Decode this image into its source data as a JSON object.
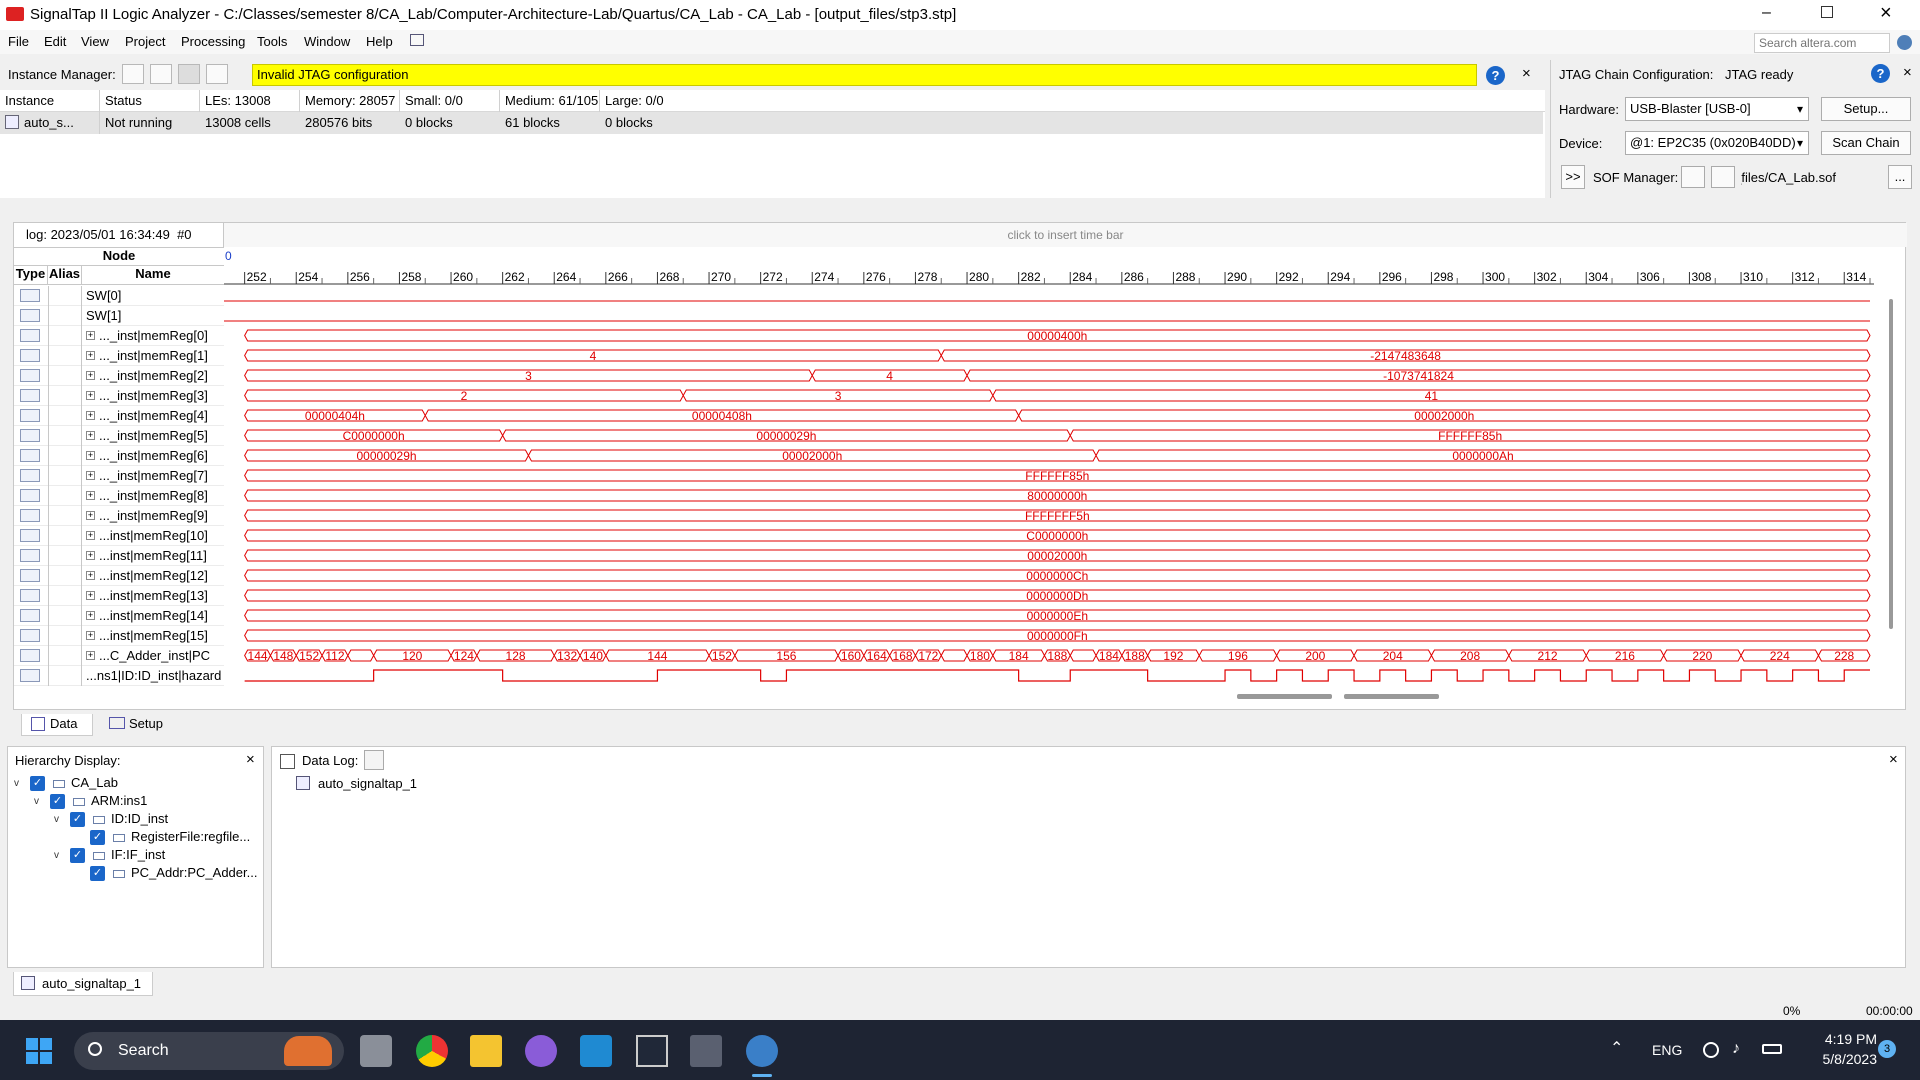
{
  "window": {
    "title": "SignalTap II Logic Analyzer - C:/Classes/semester 8/CA_Lab/Computer-Architecture-Lab/Quartus/CA_Lab - CA_Lab - [output_files/stp3.stp]"
  },
  "menu": [
    "File",
    "Edit",
    "View",
    "Project",
    "Processing",
    "Tools",
    "Window",
    "Help"
  ],
  "search": {
    "placeholder": "Search altera.com"
  },
  "instance_manager": {
    "label": "Instance Manager:",
    "status": "Invalid JTAG configuration",
    "headers": [
      "Instance",
      "Status",
      "LEs: 13008",
      "Memory: 28057",
      "Small: 0/0",
      "Medium: 61/105",
      "Large: 0/0"
    ],
    "row": [
      "auto_s...",
      "Not running",
      "13008 cells",
      "280576 bits",
      "0 blocks",
      "61 blocks",
      "0 blocks"
    ]
  },
  "jtag": {
    "label": "JTAG Chain Configuration:",
    "status": "JTAG ready",
    "hardware_label": "Hardware:",
    "hardware": "USB-Blaster [USB-0]",
    "setup": "Setup...",
    "device_label": "Device:",
    "device": "@1: EP2C35 (0x020B40DD)",
    "scan": "Scan Chain",
    "sof_arrow": ">>",
    "sof_label": "SOF Manager:",
    "sof_file": "output_files/CA_Lab.sof",
    "more": "..."
  },
  "waveform": {
    "log": "log: 2023/05/01 16:34:49  #0",
    "insert_hint": "click to insert time bar",
    "node_header": "Node",
    "type_header": "Type",
    "alias_header": "Alias",
    "name_header": "Name",
    "cursor": "0",
    "ticks": [
      "252",
      "254",
      "256",
      "258",
      "260",
      "262",
      "264",
      "266",
      "268",
      "270",
      "272",
      "274",
      "276",
      "278",
      "280",
      "282",
      "284",
      "286",
      "288",
      "290",
      "292",
      "294",
      "296",
      "298",
      "300",
      "302",
      "304",
      "306",
      "308",
      "310",
      "312",
      "314"
    ],
    "signals": [
      {
        "name": "SW[0]",
        "kind": "in",
        "segments": []
      },
      {
        "name": "SW[1]",
        "kind": "in",
        "segments": []
      },
      {
        "name": "..._inst|memReg[0]",
        "kind": "bus",
        "segments": [
          [
            252,
            316,
            "00000400h"
          ]
        ]
      },
      {
        "name": "..._inst|memReg[1]",
        "kind": "bus",
        "segments": [
          [
            252,
            279,
            "4"
          ],
          [
            279,
            316,
            "-2147483648"
          ]
        ]
      },
      {
        "name": "..._inst|memReg[2]",
        "kind": "bus",
        "segments": [
          [
            252,
            274,
            "3"
          ],
          [
            274,
            280,
            "4"
          ],
          [
            280,
            316,
            "-1073741824"
          ]
        ]
      },
      {
        "name": "..._inst|memReg[3]",
        "kind": "bus",
        "segments": [
          [
            252,
            269,
            "2"
          ],
          [
            269,
            281,
            "3"
          ],
          [
            281,
            316,
            "41"
          ]
        ]
      },
      {
        "name": "..._inst|memReg[4]",
        "kind": "bus",
        "segments": [
          [
            252,
            259,
            "00000404h"
          ],
          [
            259,
            282,
            "00000408h"
          ],
          [
            282,
            316,
            "00002000h"
          ]
        ]
      },
      {
        "name": "..._inst|memReg[5]",
        "kind": "bus",
        "segments": [
          [
            252,
            262,
            "C0000000h"
          ],
          [
            262,
            284,
            "00000029h"
          ],
          [
            284,
            316,
            "FFFFFF85h"
          ]
        ]
      },
      {
        "name": "..._inst|memReg[6]",
        "kind": "bus",
        "segments": [
          [
            252,
            263,
            "00000029h"
          ],
          [
            263,
            285,
            "00002000h"
          ],
          [
            285,
            316,
            "0000000Ah"
          ]
        ]
      },
      {
        "name": "..._inst|memReg[7]",
        "kind": "bus",
        "segments": [
          [
            252,
            316,
            "FFFFFF85h"
          ]
        ]
      },
      {
        "name": "..._inst|memReg[8]",
        "kind": "bus",
        "segments": [
          [
            252,
            316,
            "80000000h"
          ]
        ]
      },
      {
        "name": "..._inst|memReg[9]",
        "kind": "bus",
        "segments": [
          [
            252,
            316,
            "FFFFFFF5h"
          ]
        ]
      },
      {
        "name": "...inst|memReg[10]",
        "kind": "bus",
        "segments": [
          [
            252,
            316,
            "C0000000h"
          ]
        ]
      },
      {
        "name": "...inst|memReg[11]",
        "kind": "bus",
        "segments": [
          [
            252,
            316,
            "00002000h"
          ]
        ]
      },
      {
        "name": "...inst|memReg[12]",
        "kind": "bus",
        "segments": [
          [
            252,
            316,
            "0000000Ch"
          ]
        ]
      },
      {
        "name": "...inst|memReg[13]",
        "kind": "bus",
        "segments": [
          [
            252,
            316,
            "0000000Dh"
          ]
        ]
      },
      {
        "name": "...inst|memReg[14]",
        "kind": "bus",
        "segments": [
          [
            252,
            316,
            "0000000Eh"
          ]
        ]
      },
      {
        "name": "...inst|memReg[15]",
        "kind": "bus",
        "segments": [
          [
            252,
            316,
            "0000000Fh"
          ]
        ]
      },
      {
        "name": "...C_Adder_inst|PC",
        "kind": "bus",
        "segments": [
          [
            252,
            253,
            "144"
          ],
          [
            253,
            254,
            "148"
          ],
          [
            254,
            255,
            "152"
          ],
          [
            255,
            256,
            "112"
          ],
          [
            256,
            257,
            ""
          ],
          [
            257,
            260,
            "120"
          ],
          [
            260,
            261,
            "124"
          ],
          [
            261,
            264,
            "128"
          ],
          [
            264,
            265,
            "132"
          ],
          [
            265,
            266,
            "140"
          ],
          [
            266,
            270,
            "144"
          ],
          [
            270,
            271,
            "152"
          ],
          [
            271,
            275,
            "156"
          ],
          [
            275,
            276,
            "160"
          ],
          [
            276,
            277,
            "164"
          ],
          [
            277,
            278,
            "168"
          ],
          [
            278,
            279,
            "172"
          ],
          [
            279,
            280,
            ""
          ],
          [
            280,
            281,
            "180"
          ],
          [
            281,
            283,
            "184"
          ],
          [
            283,
            284,
            "188"
          ],
          [
            284,
            285,
            ""
          ],
          [
            285,
            286,
            "184"
          ],
          [
            286,
            287,
            "188"
          ],
          [
            287,
            289,
            "192"
          ],
          [
            289,
            292,
            "196"
          ],
          [
            292,
            295,
            "200"
          ],
          [
            295,
            298,
            "204"
          ],
          [
            298,
            301,
            "208"
          ],
          [
            301,
            304,
            "212"
          ],
          [
            304,
            307,
            "216"
          ],
          [
            307,
            310,
            "220"
          ],
          [
            310,
            313,
            "224"
          ],
          [
            313,
            316,
            "228"
          ]
        ]
      },
      {
        "name": "...ns1|ID:ID_inst|hazard",
        "kind": "bit",
        "segments": [
          [
            252,
            257,
            0
          ],
          [
            257,
            262,
            1
          ],
          [
            262,
            268,
            0
          ],
          [
            268,
            272,
            1
          ],
          [
            272,
            273,
            0
          ],
          [
            273,
            282,
            1
          ],
          [
            282,
            284,
            0
          ],
          [
            284,
            287,
            1
          ],
          [
            287,
            290,
            0
          ],
          [
            290,
            291,
            1
          ],
          [
            291,
            292,
            0
          ],
          [
            292,
            293,
            1
          ],
          [
            293,
            294,
            0
          ],
          [
            294,
            295,
            1
          ],
          [
            295,
            296,
            0
          ],
          [
            296,
            297,
            1
          ],
          [
            297,
            298,
            0
          ],
          [
            298,
            299,
            1
          ],
          [
            299,
            300,
            0
          ],
          [
            300,
            301,
            1
          ],
          [
            301,
            302,
            0
          ],
          [
            302,
            303,
            1
          ],
          [
            303,
            304,
            0
          ],
          [
            304,
            305,
            1
          ],
          [
            305,
            306,
            0
          ],
          [
            306,
            307,
            1
          ],
          [
            307,
            308,
            0
          ],
          [
            308,
            309,
            1
          ],
          [
            309,
            310,
            0
          ],
          [
            310,
            311,
            1
          ],
          [
            311,
            312,
            0
          ],
          [
            312,
            313,
            1
          ],
          [
            313,
            314,
            0
          ],
          [
            314,
            316,
            1
          ]
        ]
      }
    ]
  },
  "tabs": {
    "data": "Data",
    "setup": "Setup"
  },
  "hierarchy": {
    "label": "Hierarchy Display:",
    "nodes": [
      {
        "label": "CA_Lab",
        "depth": 0,
        "expander": "v"
      },
      {
        "label": "ARM:ins1",
        "depth": 1,
        "expander": "v"
      },
      {
        "label": "ID:ID_inst",
        "depth": 2,
        "expander": "v"
      },
      {
        "label": "RegisterFile:regfile...",
        "depth": 3,
        "expander": ""
      },
      {
        "label": "IF:IF_inst",
        "depth": 2,
        "expander": "v"
      },
      {
        "label": "PC_Addr:PC_Adder...",
        "depth": 3,
        "expander": ""
      }
    ]
  },
  "datalog": {
    "label": "Data Log:",
    "item": "auto_signaltap_1"
  },
  "bottom_tab": "auto_signaltap_1",
  "status": {
    "percent": "0%",
    "time": "00:00:00"
  },
  "taskbar": {
    "search": "Search",
    "lang": "ENG",
    "time": "4:19 PM",
    "date": "5/8/2023",
    "badge": "3"
  },
  "colors": {
    "wave": "#e00000",
    "highlight": "#ffff00",
    "accent": "#1a66c9"
  }
}
